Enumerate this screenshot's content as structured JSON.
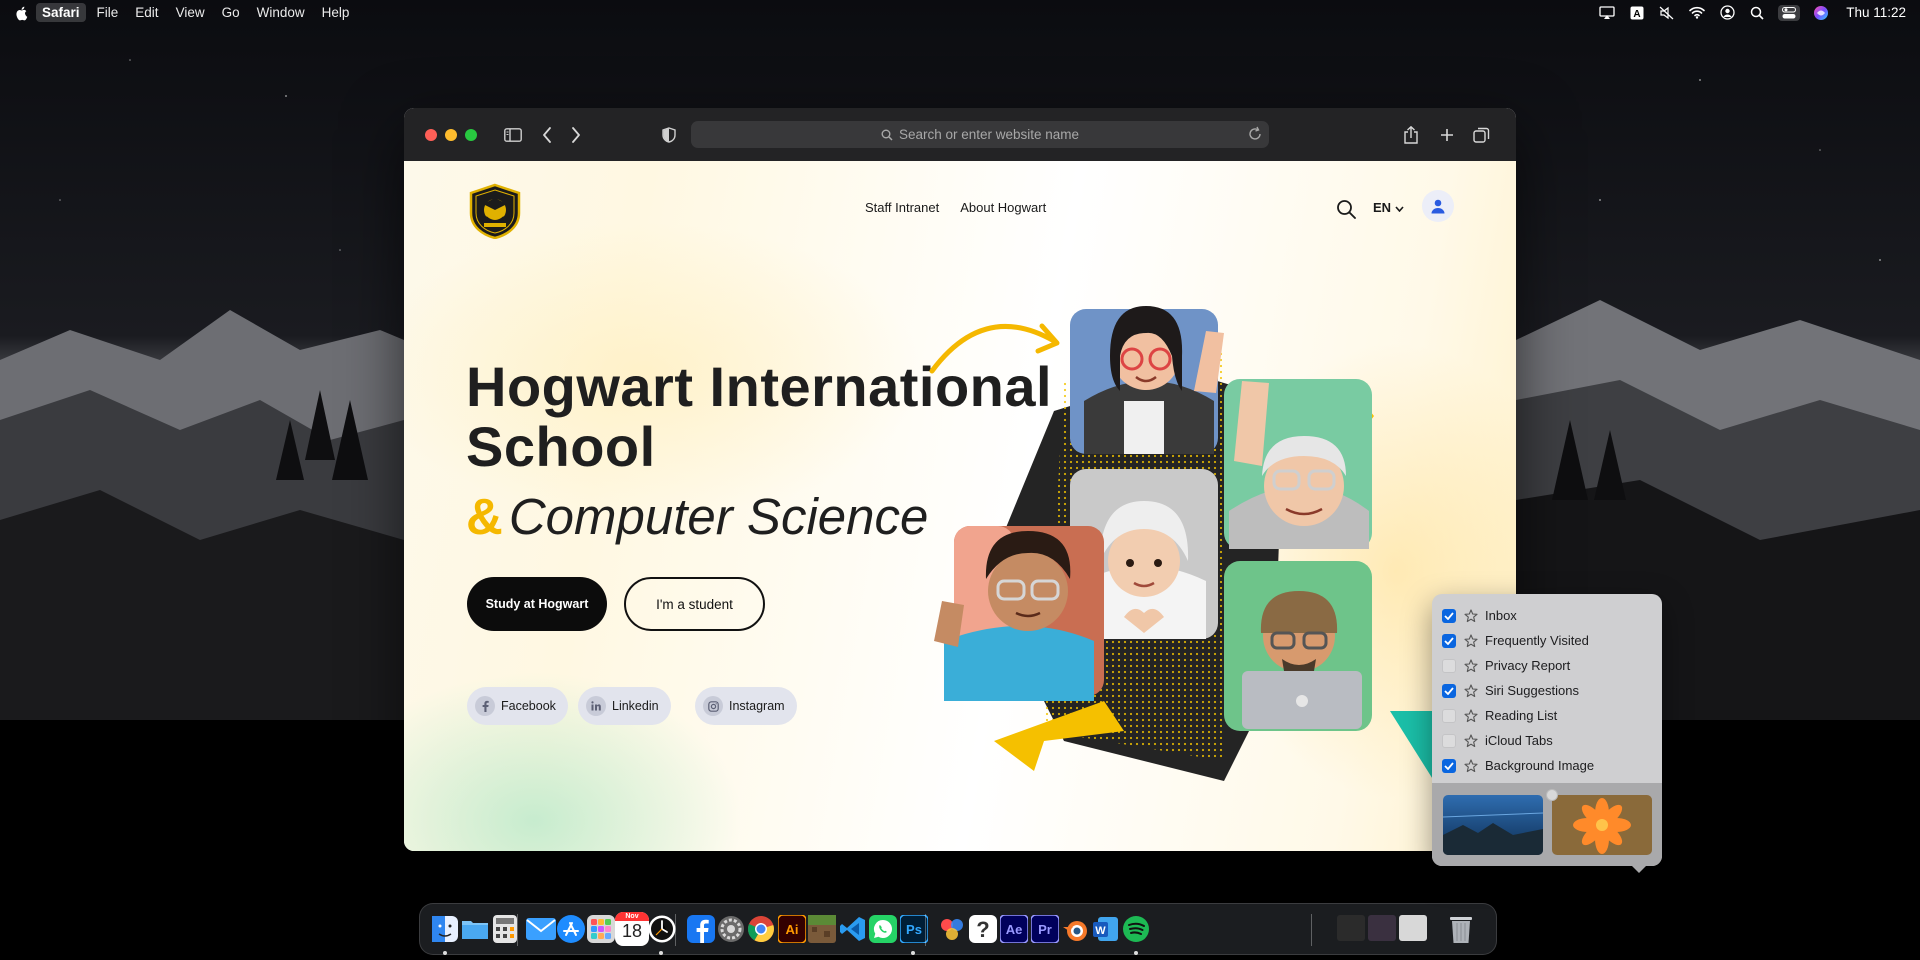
{
  "menubar": {
    "app_name": "Safari",
    "menus": [
      "File",
      "Edit",
      "View",
      "Go",
      "Window",
      "Help"
    ],
    "clock": "Thu 11:22",
    "status_icons": [
      "airplay-icon",
      "keyboard-input-icon",
      "mute-icon",
      "wifi-icon",
      "user-account-icon",
      "search-icon",
      "control-center-icon",
      "siri-icon"
    ]
  },
  "browser": {
    "search_placeholder": "Search or enter website name"
  },
  "site": {
    "nav": [
      "Staff Intranet",
      "About Hogwart"
    ],
    "language": "EN",
    "title_line1": "Hogwart International",
    "title_line2": "School",
    "subtitle_amp": "&",
    "subtitle": "Computer Science",
    "cta_primary": "Study at Hogwart",
    "cta_secondary": "I'm a student",
    "socials": [
      "Facebook",
      "Linkedin",
      "Instagram"
    ],
    "colors": {
      "accent": "#f5b800",
      "dark": "#0c0c0c"
    }
  },
  "start_page_popover": {
    "items": [
      {
        "label": "Inbox",
        "checked": true
      },
      {
        "label": "Frequently Visited",
        "checked": true
      },
      {
        "label": "Privacy Report",
        "checked": false
      },
      {
        "label": "Siri Suggestions",
        "checked": true
      },
      {
        "label": "Reading List",
        "checked": false
      },
      {
        "label": "iCloud Tabs",
        "checked": false
      },
      {
        "label": "Background Image",
        "checked": true
      }
    ]
  },
  "dock": {
    "apps": [
      "Finder",
      "Files",
      "Calculator",
      "Mail",
      "App Store",
      "Launchpad",
      "Calendar",
      "Clock",
      "Facebook",
      "System Settings",
      "Chrome",
      "Illustrator",
      "Minecraft",
      "VS Code",
      "WhatsApp",
      "Photoshop",
      "DaVinci Resolve",
      "Help",
      "After Effects",
      "Premiere Pro",
      "Blender",
      "Word",
      "Spotify"
    ],
    "calendar_day": "18",
    "calendar_month": "Nov"
  }
}
